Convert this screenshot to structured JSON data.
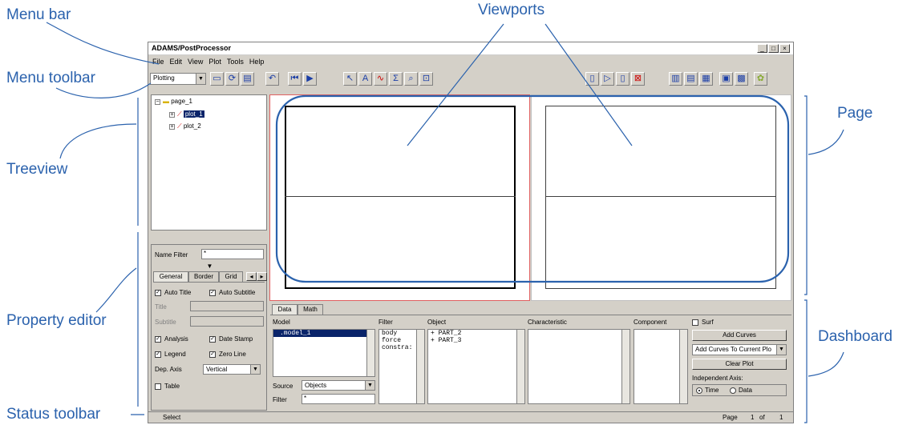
{
  "callouts": {
    "menu_bar": "Menu bar",
    "menu_toolbar": "Menu toolbar",
    "treeview": "Treeview",
    "property_editor": "Property editor",
    "status_toolbar": "Status toolbar",
    "viewports": "Viewports",
    "page": "Page",
    "dashboard": "Dashboard"
  },
  "colors": {
    "callout": "#2b62ad",
    "selection": "#0a246a",
    "viewport_border": "#e06060"
  },
  "window": {
    "title": "ADAMS/PostProcessor",
    "min": "_",
    "max": "□",
    "close": "×"
  },
  "menu": [
    "File",
    "Edit",
    "View",
    "Plot",
    "Tools",
    "Help"
  ],
  "toolbar": {
    "mode": "Plotting",
    "icons": [
      "open-icon",
      "reload-icon",
      "print-icon",
      "undo-icon",
      "first-frame-icon",
      "play-icon",
      "select-icon",
      "text-icon",
      "curve-icon",
      "math-icon",
      "zoom-icon",
      "fit-icon",
      "new-page-icon",
      "next-page-icon",
      "page-icon",
      "delete-page-icon",
      "layout1-icon",
      "layout2-icon",
      "layout3-icon",
      "layout4-icon",
      "layout5-icon",
      "settings-icon"
    ]
  },
  "tree": {
    "root": "page_1",
    "items": [
      "plot_1",
      "plot_2"
    ]
  },
  "property_editor": {
    "name_filter_label": "Name Filter",
    "name_filter_value": "*",
    "tabs": [
      "General",
      "Border",
      "Grid"
    ],
    "auto_title": "Auto Title",
    "auto_subtitle": "Auto Subtitle",
    "title_label": "Title",
    "subtitle_label": "Subtitle",
    "analysis": "Analysis",
    "date_stamp": "Date Stamp",
    "legend": "Legend",
    "zero_line": "Zero Line",
    "dep_axis_label": "Dep. Axis",
    "dep_axis_value": "Vertical",
    "table": "Table"
  },
  "dashboard": {
    "tabs": [
      "Data",
      "Math"
    ],
    "model_label": "Model",
    "model_items": [
      ".model_1"
    ],
    "filter_label": "Filter",
    "filter_items": [
      "body",
      "force",
      "constra:"
    ],
    "object_label": "Object",
    "object_items": [
      "+ PART_2",
      "+ PART_3"
    ],
    "characteristic_label": "Characteristic",
    "component_label": "Component",
    "surf": "Surf",
    "source_label": "Source",
    "source_value": "Objects",
    "filter_input_label": "Filter",
    "filter_input_value": "*",
    "add_curves": "Add Curves",
    "add_mode": "Add Curves To Current Plo",
    "clear_plot": "Clear Plot",
    "indep_axis": "Independent Axis:",
    "time": "Time",
    "data": "Data"
  },
  "status": {
    "text": "Select",
    "page_label": "Page",
    "page_num": "1",
    "of": "of",
    "total": "1"
  }
}
